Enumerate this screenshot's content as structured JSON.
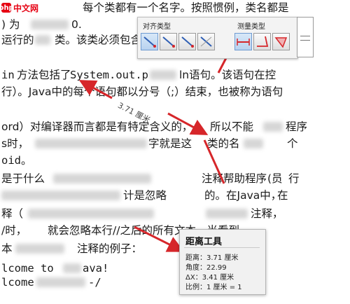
{
  "logo": {
    "mark": "php",
    "text": "中文网"
  },
  "document": {
    "lines": [
      {
        "text": "每个类都有一个名字。按照惯例，类名都是"
      },
      {
        "text": ") 为"
      },
      {
        "text": "0."
      },
      {
        "text": "运行的"
      },
      {
        "text": "类。该类必须包含"
      },
      {
        "text": "in"
      },
      {
        "text": "方法包括了"
      },
      {
        "text": "System.out.p"
      },
      {
        "text": "ln语句。该语句在控"
      },
      {
        "text": "行）。Java中的每个语句都以分号（;）结束，也被称为语句"
      },
      {
        "text": "ord）对编译器而言都是有特定含义的，"
      },
      {
        "text": "所以不能"
      },
      {
        "text": "程序"
      },
      {
        "text": "s时，"
      },
      {
        "text": "字就是这"
      },
      {
        "text": "类的名"
      },
      {
        "text": "个"
      },
      {
        "text": "oid。"
      },
      {
        "text": "是于什么"
      },
      {
        "text": "注释帮助程序"
      },
      {
        "text": "(员"
      },
      {
        "text": "行"
      },
      {
        "text": "计是忽略"
      },
      {
        "text": "的。在Java中，"
      },
      {
        "text": "在"
      },
      {
        "text": "释（"
      },
      {
        "text": "注释，"
      },
      {
        "text": "/时，"
      },
      {
        "text": "就会忽略本行//之后的所有文本。当看到"
      },
      {
        "text": "本"
      },
      {
        "text": "注释的例子："
      },
      {
        "text": "lcome to"
      },
      {
        "text": "ava!"
      },
      {
        "text": "lcome"
      },
      {
        "text": "-/"
      }
    ]
  },
  "toolbar": {
    "align_title": "对齐类型",
    "measure_title": "测量类型",
    "align_buttons": [
      "align-free-icon",
      "align-horizontal-icon",
      "align-vertical-icon",
      "align-angle-icon"
    ],
    "measure_buttons": [
      "measure-distance-icon",
      "measure-angle-icon",
      "measure-area-icon"
    ]
  },
  "measurement": {
    "label": "3.71 厘米"
  },
  "info": {
    "title": "距离工具",
    "distance": "距离：3.71 厘米",
    "angle": "角度：22.99",
    "dx": "ΔX：3.41 厘米",
    "scale": "比例：1 厘米 = 1"
  },
  "colors": {
    "arrow": "#d6262a",
    "accent": "#e60012"
  }
}
